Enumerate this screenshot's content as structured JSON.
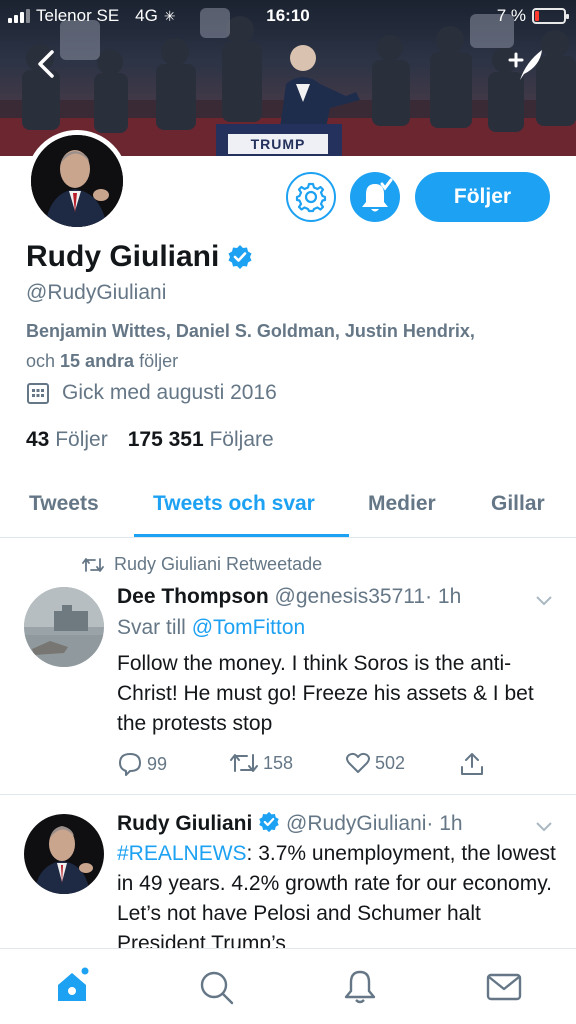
{
  "status_bar": {
    "carrier": "Telenor SE",
    "network": "4G",
    "time": "16:10",
    "battery": "7 %",
    "battery_level_percent": 7
  },
  "banner": {
    "sign_text": "TRUMP"
  },
  "profile": {
    "name": "Rudy Giuliani",
    "handle": "@RudyGiuliani",
    "followed_by_names": "Benjamin Wittes, Daniel S. Goldman, Justin Hendrix,",
    "followed_by_prefix": "och ",
    "followed_by_count": "15 andra",
    "followed_by_suffix": " följer",
    "joined": "Gick med augusti 2016",
    "following_count": "43",
    "following_label": "Följer",
    "followers_count": "175 351",
    "followers_label": "Följare",
    "follow_button": "Följer"
  },
  "tabs": [
    {
      "label": "Tweets",
      "active": false
    },
    {
      "label": "Tweets och svar",
      "active": true
    },
    {
      "label": "Medier",
      "active": false
    },
    {
      "label": "Gillar",
      "active": false
    }
  ],
  "tweets": [
    {
      "retweet_label": "Rudy Giuliani Retweetade",
      "name": "Dee Thompson",
      "handle": "@genesis35711",
      "time": "· 1h",
      "reply_prefix": "Svar till ",
      "reply_to": "@TomFitton",
      "text": "Follow the money. I think Soros is the anti-Christ! He must go!  Freeze his assets & I bet the protests stop",
      "replies": "99",
      "retweets": "158",
      "likes": "502"
    },
    {
      "name": "Rudy Giuliani",
      "handle": "@RudyGiuliani",
      "time": "· 1h",
      "hashtag": "#REALNEWS",
      "text": ": 3.7% unemployment, the lowest in 49 years. 4.2% growth rate for our economy. Let’s not have Pelosi and Schumer halt President Trump’s"
    }
  ],
  "colors": {
    "accent": "#1da1f2",
    "muted": "#657786",
    "text": "#14171a",
    "divider": "#e1e8ed"
  },
  "icons": {
    "back": "chevron-left-icon",
    "compose": "compose-icon",
    "settings": "gear-icon",
    "notify": "bell-check-icon",
    "calendar": "calendar-icon",
    "retweet": "retweet-icon",
    "reply": "reply-icon",
    "like": "heart-icon",
    "share": "share-icon",
    "home": "home-icon",
    "search": "search-icon",
    "notifications": "bell-icon",
    "messages": "mail-icon"
  }
}
